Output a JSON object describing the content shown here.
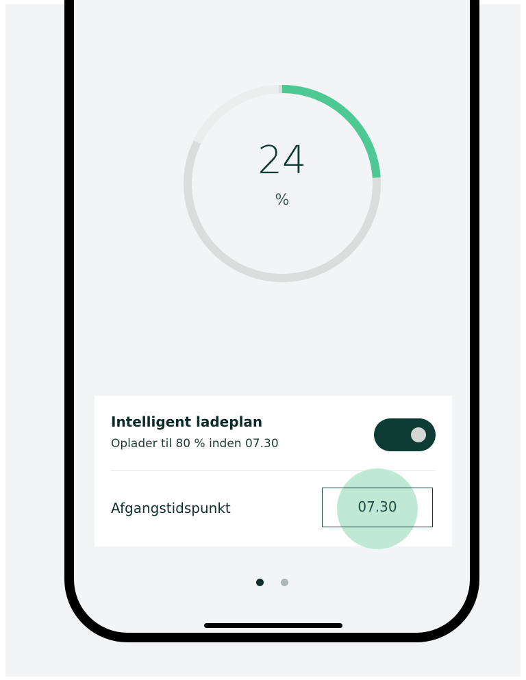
{
  "battery": {
    "value": "24",
    "unit": "%",
    "level_percent": 24,
    "colors": {
      "fill": "#4fc994",
      "track": "#d9dedd",
      "track_light": "#eceeee"
    }
  },
  "charge_plan": {
    "title": "Intelligent ladeplan",
    "subtitle": "Oplader til 80 % inden 07.30",
    "toggle_on": true
  },
  "departure": {
    "label": "Afgangstidspunkt",
    "time": "07.30"
  },
  "pager": {
    "page_count": 2,
    "current_page": 1
  },
  "colors": {
    "accent_dark": "#0e3b33",
    "accent_green": "#4fc994",
    "tap_highlight": "#bfe9d4"
  }
}
